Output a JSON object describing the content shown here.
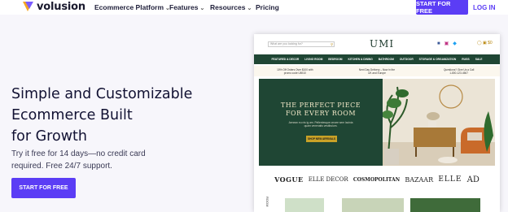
{
  "nav": {
    "brand": "volusion",
    "items": [
      {
        "label": "Ecommerce Platform",
        "chevron": "⌄"
      },
      {
        "label": "Features",
        "chevron": "⌄"
      },
      {
        "label": "Resources",
        "chevron": "⌄"
      },
      {
        "label": "Pricing",
        "chevron": ""
      }
    ],
    "cta": "START FOR FREE",
    "login": "LOG IN"
  },
  "hero": {
    "title_lines": [
      "Simple and Customizable",
      "Ecommerce Built",
      "for Growth"
    ],
    "subtitle_lines": [
      "Try it free for 14 days—no credit card",
      "required. Free 24/7 support."
    ],
    "cta": "START FOR FREE"
  },
  "preview": {
    "search_placeholder": "What are you looking for?",
    "brand": "UMI",
    "cart_count": "$0",
    "menu": [
      "FEATURED & DECOR",
      "LIVING ROOM",
      "BEDROOM",
      "KITCHEN & DINING",
      "BATHROOM",
      "OUTDOOR",
      "STORAGE & ORGANIZATION",
      "RUGS",
      "SALE"
    ],
    "promos": [
      {
        "line1": "10% Off Orders Over $100 with",
        "line2": "promo code UMI10"
      },
      {
        "line1": "Next Day Delivery – Now in the",
        "line2": "UK and Europe"
      },
      {
        "line1": "Questions? Give Us a Call",
        "line2": "1-800-123-4567"
      }
    ],
    "hero_title_lines": [
      "THE PERFECT PIECE",
      "FOR EVERY ROOM"
    ],
    "hero_desc": "Aenean eu nis ig am. Pellentesque ornare sem lacinia quam venenatis vestibulum.",
    "hero_button": "SHOP NEW ARRIVALS",
    "press": [
      "VOGUE",
      "ELLE DECOR",
      "COSMOPOLITAN",
      "BAZAAR",
      "ELLE",
      "AD"
    ],
    "bottom_label": "ROOM"
  },
  "colors": {
    "accent": "#5b3df5",
    "store_green": "#1f4634",
    "store_gold": "#c9a227",
    "hero_bg": "#f7f6fb"
  }
}
